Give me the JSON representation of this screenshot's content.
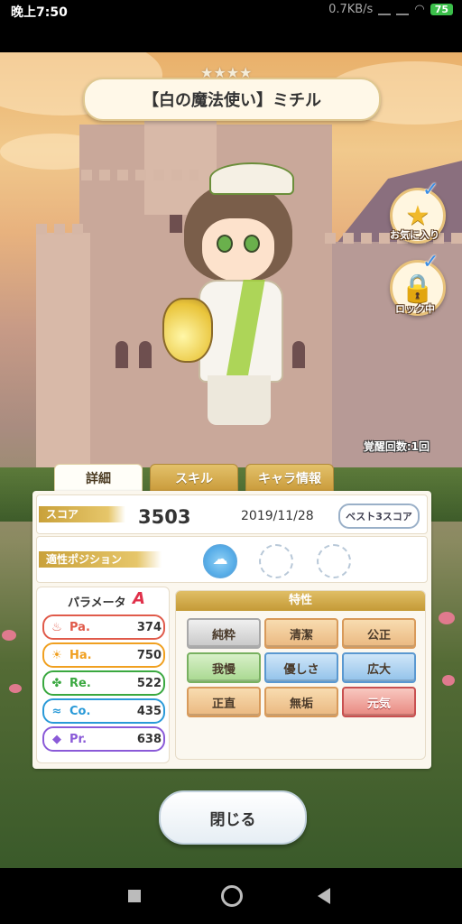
{
  "status": {
    "time": "晚上7:50",
    "net": "0.7KB/s",
    "battery": "75"
  },
  "card": {
    "rarity_stars": "★★★★",
    "name": "【白の魔法使い】ミチル"
  },
  "side": {
    "favorite_label": "お気に入り",
    "lock_label": "ロック中",
    "awakening": "覚醒回数:1回"
  },
  "tabs": [
    {
      "label": "詳細",
      "active": true
    },
    {
      "label": "スキル",
      "active": false
    },
    {
      "label": "キャラ情報",
      "active": false
    }
  ],
  "score": {
    "label": "スコア",
    "value": "3503",
    "date": "2019/11/28",
    "best3_button": "ベスト3スコア"
  },
  "position": {
    "label": "適性ポジション"
  },
  "params": {
    "title": "パラメータ",
    "rank": "A",
    "stats": [
      {
        "abbr": "Pa.",
        "value": "374",
        "color": "#e05a4a",
        "icon": "flame-icon"
      },
      {
        "abbr": "Ha.",
        "value": "750",
        "color": "#f0a020",
        "icon": "sun-icon"
      },
      {
        "abbr": "Re.",
        "value": "522",
        "color": "#3aa840",
        "icon": "clover-icon"
      },
      {
        "abbr": "Co.",
        "value": "435",
        "color": "#2a9ad8",
        "icon": "wave-icon"
      },
      {
        "abbr": "Pr.",
        "value": "638",
        "color": "#8a5ad8",
        "icon": "diamond-icon"
      }
    ]
  },
  "traits": {
    "title": "特性",
    "items": [
      "純粋",
      "清潔",
      "公正",
      "我慢",
      "優しさ",
      "広大",
      "正直",
      "無垢",
      "元気"
    ]
  },
  "close_button": "閉じる"
}
